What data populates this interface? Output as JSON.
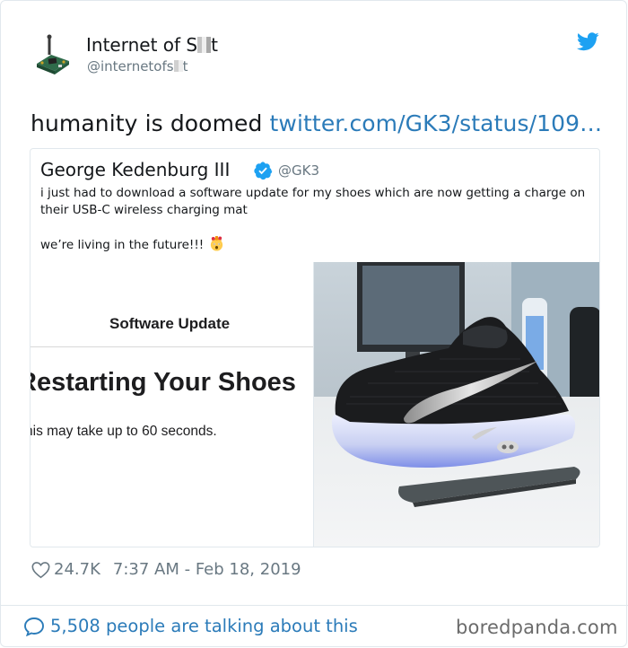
{
  "author": {
    "name_prefix": "Internet of S",
    "name_suffix": "t",
    "handle_prefix": "@internetofs",
    "handle_suffix": "t",
    "avatar_icon": "iot-device-avatar"
  },
  "tweet": {
    "text": "humanity is doomed",
    "link": "twitter.com/GK3/status/109…"
  },
  "quoted_tweet": {
    "name": "George Kedenburg III",
    "handle": "@GK3",
    "line1": "i just had to download a software update for my shoes which are now getting a charge on their USB-C wireless charging mat",
    "line2": "we’re living in the future!!!",
    "emoji": "exploding-head-emoji"
  },
  "media": {
    "update_title": "Software Update",
    "update_heading": "Restarting Your Shoes",
    "update_subtext": "his may take up to 60 seconds.",
    "photo": "black-sneaker-on-charging-mat"
  },
  "footer": {
    "likes": "24.7K",
    "timestamp": "7:37 AM - Feb 18, 2019",
    "talking": "5,508 people are talking about this"
  },
  "watermark": "boredpanda.com",
  "colors": {
    "link": "#2b7bb9",
    "muted": "#697882",
    "border": "#e1e8ed",
    "verified": "#1da1f2"
  }
}
